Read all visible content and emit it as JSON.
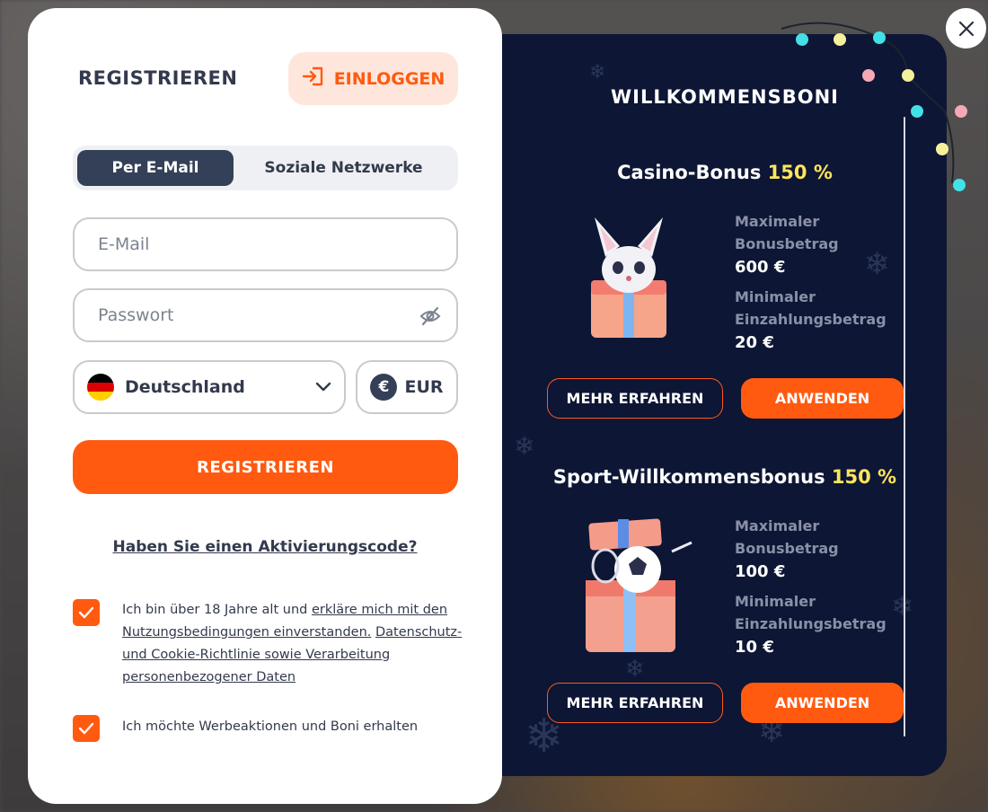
{
  "form": {
    "title": "REGISTRIEREN",
    "login_label": "EINLOGGEN",
    "tabs": [
      {
        "label": "Per E-Mail",
        "active": true
      },
      {
        "label": "Soziale Netzwerke",
        "active": false
      }
    ],
    "email": {
      "value": "",
      "placeholder": "E-Mail"
    },
    "password": {
      "value": "",
      "placeholder": "Passwort"
    },
    "country": {
      "value": "Deutschland",
      "flag_colors": [
        "#000000",
        "#dd0000",
        "#ffce00"
      ]
    },
    "currency": {
      "symbol": "€",
      "value": "EUR"
    },
    "register_label": "REGISTRIEREN",
    "activation_link": "Haben Sie einen Aktivierungscode?",
    "terms": {
      "checked": true,
      "part1": "Ich bin über 18 Jahre alt und ",
      "link1": "erkläre mich mit den Nutzungsbedingungen einverstanden.",
      "part2": " ",
      "link2": "Datenschutz- und Cookie-Richtlinie sowie Verarbeitung personenbezogener Daten"
    },
    "promo": {
      "checked": true,
      "text": "Ich möchte Werbeaktionen und Boni erhalten"
    }
  },
  "bonus": {
    "title": "WILLKOMMENSBONI",
    "items": [
      {
        "name": "Casino-Bonus",
        "percent": "150 %",
        "max_label": "Maximaler Bonusbetrag",
        "max_value": "600 €",
        "min_label": "Minimaler Einzahlungsbetrag",
        "min_value": "20 €",
        "more_label": "MEHR ERFAHREN",
        "apply_label": "ANWENDEN"
      },
      {
        "name": "Sport-Willkommensbonus",
        "percent": "150 %",
        "max_label": "Maximaler Bonusbetrag",
        "max_value": "100 €",
        "min_label": "Minimaler Einzahlungsbetrag",
        "min_value": "10 €",
        "more_label": "MEHR ERFAHREN",
        "apply_label": "ANWENDEN"
      }
    ]
  },
  "colors": {
    "accent": "#ff5a10",
    "dark_panel": "#0d1634",
    "highlight": "#ffe55c"
  },
  "icons": {
    "login": "login-arrow-icon",
    "eye": "eye-off-icon",
    "close": "close-icon",
    "chevron": "chevron-down-icon",
    "check": "checkmark-icon"
  }
}
